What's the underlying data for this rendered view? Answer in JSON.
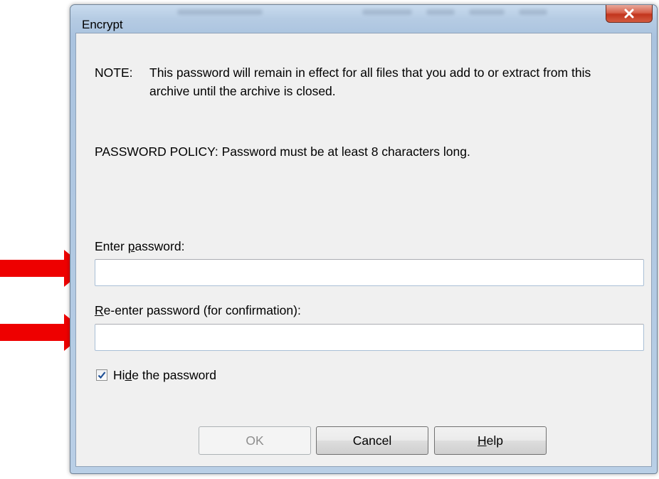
{
  "dialog": {
    "title": "Encrypt",
    "note": {
      "label": "NOTE:",
      "text": "This password will remain in effect for all files that you add to or extract from this archive until the archive is closed."
    },
    "policy": "PASSWORD POLICY: Password must be at least 8 characters long.",
    "enter_password": {
      "label_pre": "Enter ",
      "label_accel": "p",
      "label_post": "assword:",
      "value": ""
    },
    "reenter_password": {
      "label_pre": "",
      "label_accel": "R",
      "label_post": "e-enter password (for confirmation):",
      "value": ""
    },
    "hide_password": {
      "checked": true,
      "label_pre": "Hi",
      "label_accel": "d",
      "label_post": "e the password"
    },
    "buttons": {
      "ok": "OK",
      "cancel": "Cancel",
      "help_accel": "H",
      "help_post": "elp"
    }
  },
  "annotations": {
    "arrow_color": "#ee0000"
  }
}
